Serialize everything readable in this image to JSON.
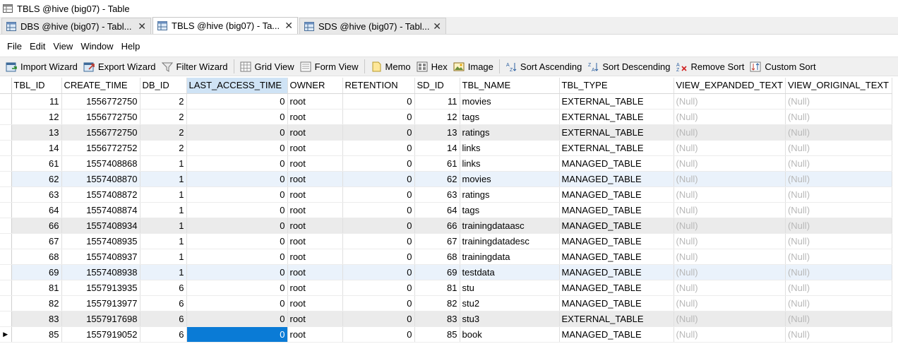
{
  "window": {
    "title": "TBLS @hive (big07) - Table"
  },
  "tabs": [
    {
      "label": "DBS @hive (big07) - Tabl...",
      "close": "✕",
      "active": false
    },
    {
      "label": "TBLS @hive (big07) - Ta...",
      "close": "✕",
      "active": true
    },
    {
      "label": "SDS @hive (big07) - Tabl...",
      "close": "✕",
      "active": false
    }
  ],
  "menu": [
    "File",
    "Edit",
    "View",
    "Window",
    "Help"
  ],
  "toolbar": {
    "import_wizard": "Import Wizard",
    "export_wizard": "Export Wizard",
    "filter_wizard": "Filter Wizard",
    "grid_view": "Grid View",
    "form_view": "Form View",
    "memo": "Memo",
    "hex": "Hex",
    "image": "Image",
    "sort_ascending": "Sort Ascending",
    "sort_descending": "Sort Descending",
    "remove_sort": "Remove Sort",
    "custom_sort": "Custom Sort"
  },
  "grid": {
    "columns": [
      "TBL_ID",
      "CREATE_TIME",
      "DB_ID",
      "LAST_ACCESS_TIME",
      "OWNER",
      "RETENTION",
      "SD_ID",
      "TBL_NAME",
      "TBL_TYPE",
      "VIEW_EXPANDED_TEXT",
      "VIEW_ORIGINAL_TEXT"
    ],
    "selected_column": "LAST_ACCESS_TIME",
    "current_row_indicator": "▶",
    "rows": [
      [
        "11",
        "1556772750",
        "2",
        "0",
        "root",
        "0",
        "11",
        "movies",
        "EXTERNAL_TABLE",
        "(Null)",
        "(Null)"
      ],
      [
        "12",
        "1556772750",
        "2",
        "0",
        "root",
        "0",
        "12",
        "tags",
        "EXTERNAL_TABLE",
        "(Null)",
        "(Null)"
      ],
      [
        "13",
        "1556772750",
        "2",
        "0",
        "root",
        "0",
        "13",
        "ratings",
        "EXTERNAL_TABLE",
        "(Null)",
        "(Null)"
      ],
      [
        "14",
        "1556772752",
        "2",
        "0",
        "root",
        "0",
        "14",
        "links",
        "EXTERNAL_TABLE",
        "(Null)",
        "(Null)"
      ],
      [
        "61",
        "1557408868",
        "1",
        "0",
        "root",
        "0",
        "61",
        "links",
        "MANAGED_TABLE",
        "(Null)",
        "(Null)"
      ],
      [
        "62",
        "1557408870",
        "1",
        "0",
        "root",
        "0",
        "62",
        "movies",
        "MANAGED_TABLE",
        "(Null)",
        "(Null)"
      ],
      [
        "63",
        "1557408872",
        "1",
        "0",
        "root",
        "0",
        "63",
        "ratings",
        "MANAGED_TABLE",
        "(Null)",
        "(Null)"
      ],
      [
        "64",
        "1557408874",
        "1",
        "0",
        "root",
        "0",
        "64",
        "tags",
        "MANAGED_TABLE",
        "(Null)",
        "(Null)"
      ],
      [
        "66",
        "1557408934",
        "1",
        "0",
        "root",
        "0",
        "66",
        "trainingdataasc",
        "MANAGED_TABLE",
        "(Null)",
        "(Null)"
      ],
      [
        "67",
        "1557408935",
        "1",
        "0",
        "root",
        "0",
        "67",
        "trainingdatadesc",
        "MANAGED_TABLE",
        "(Null)",
        "(Null)"
      ],
      [
        "68",
        "1557408937",
        "1",
        "0",
        "root",
        "0",
        "68",
        "trainingdata",
        "MANAGED_TABLE",
        "(Null)",
        "(Null)"
      ],
      [
        "69",
        "1557408938",
        "1",
        "0",
        "root",
        "0",
        "69",
        "testdata",
        "MANAGED_TABLE",
        "(Null)",
        "(Null)"
      ],
      [
        "81",
        "1557913935",
        "6",
        "0",
        "root",
        "0",
        "81",
        "stu",
        "MANAGED_TABLE",
        "(Null)",
        "(Null)"
      ],
      [
        "82",
        "1557913977",
        "6",
        "0",
        "root",
        "0",
        "82",
        "stu2",
        "MANAGED_TABLE",
        "(Null)",
        "(Null)"
      ],
      [
        "83",
        "1557917698",
        "6",
        "0",
        "root",
        "0",
        "83",
        "stu3",
        "EXTERNAL_TABLE",
        "(Null)",
        "(Null)"
      ],
      [
        "85",
        "1557919052",
        "6",
        "0",
        "root",
        "0",
        "85",
        "book",
        "MANAGED_TABLE",
        "(Null)",
        "(Null)"
      ]
    ]
  },
  "colors": {
    "selection": "#0a7bd6",
    "column_highlight": "#cfe3f5",
    "alt_row": "#ebebeb",
    "hover_row": "#eaf2fb",
    "null_text": "#b8b8b8"
  }
}
